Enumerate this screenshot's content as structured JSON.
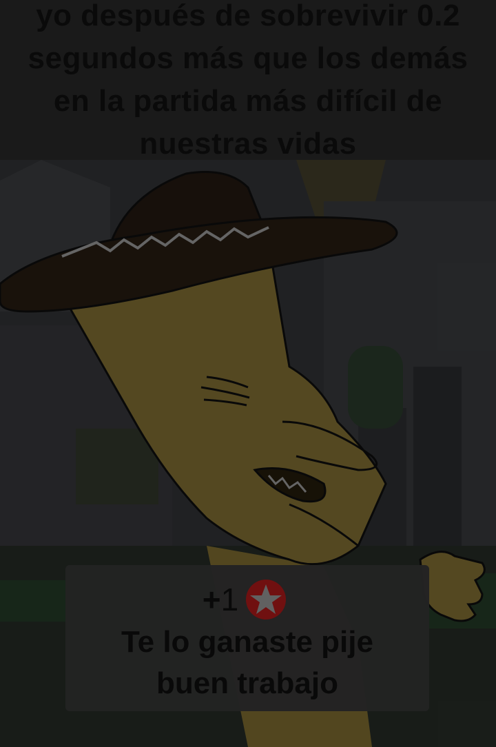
{
  "caption": {
    "lines": [
      "yo después de sobrevivir 0.2",
      "segundos más que los demás",
      "en la partida más difícil de",
      "nuestras vidas"
    ]
  },
  "reward": {
    "plus": "+",
    "amount": "1",
    "icon": "star-icon",
    "message_line1": "Te lo ganaste pije",
    "message_line2": "buen trabajo"
  },
  "colors": {
    "caption_text": "#0b0b0b",
    "star_badge": "#7a1212",
    "character_skin": "#5c4f24",
    "hat": "#1a120c"
  }
}
